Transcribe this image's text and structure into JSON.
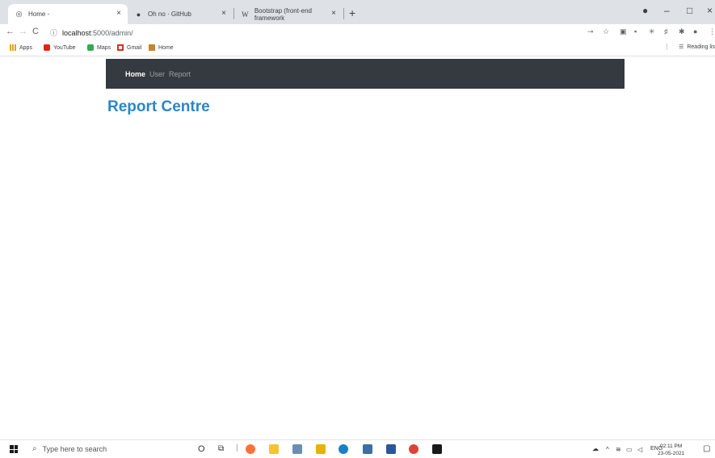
{
  "browser": {
    "tabs": [
      {
        "label": "Home -",
        "icon": "globe-icon",
        "close": "×"
      },
      {
        "label": "Oh no · GitHub",
        "icon": "github-icon",
        "close": "×"
      },
      {
        "label": "Bootstrap (front-end framework",
        "icon": "wikipedia-icon",
        "close": "×"
      }
    ],
    "new_tab": "+",
    "window_controls": {
      "minimize": "–",
      "restore": "□",
      "close": "×"
    },
    "address": {
      "host": "localhost",
      "rest": ":5000/admin/"
    },
    "nav": {
      "back": "←",
      "forward": "→",
      "reload": "C"
    },
    "bookmarks": [
      {
        "label": "Apps",
        "color": "#e3a21a"
      },
      {
        "label": "YouTube",
        "color": "#e62117"
      },
      {
        "label": "Maps",
        "color": "#34a853"
      },
      {
        "label": "Gmail",
        "color": "#d93025"
      },
      {
        "label": "Home",
        "color": "#c0862f"
      }
    ],
    "reading_list": "Reading lis"
  },
  "navbar": {
    "items": [
      {
        "label": "Home",
        "active": true
      },
      {
        "label": "User",
        "active": false
      },
      {
        "label": "Report",
        "active": false
      }
    ],
    "bg_color": "#343a40"
  },
  "main": {
    "title": "Report Centre",
    "title_color": "#2a86c8"
  },
  "taskbar": {
    "search_placeholder": "Type here to search",
    "lang": "ENG",
    "time": "02:11 PM",
    "date": "23-05-2021"
  }
}
